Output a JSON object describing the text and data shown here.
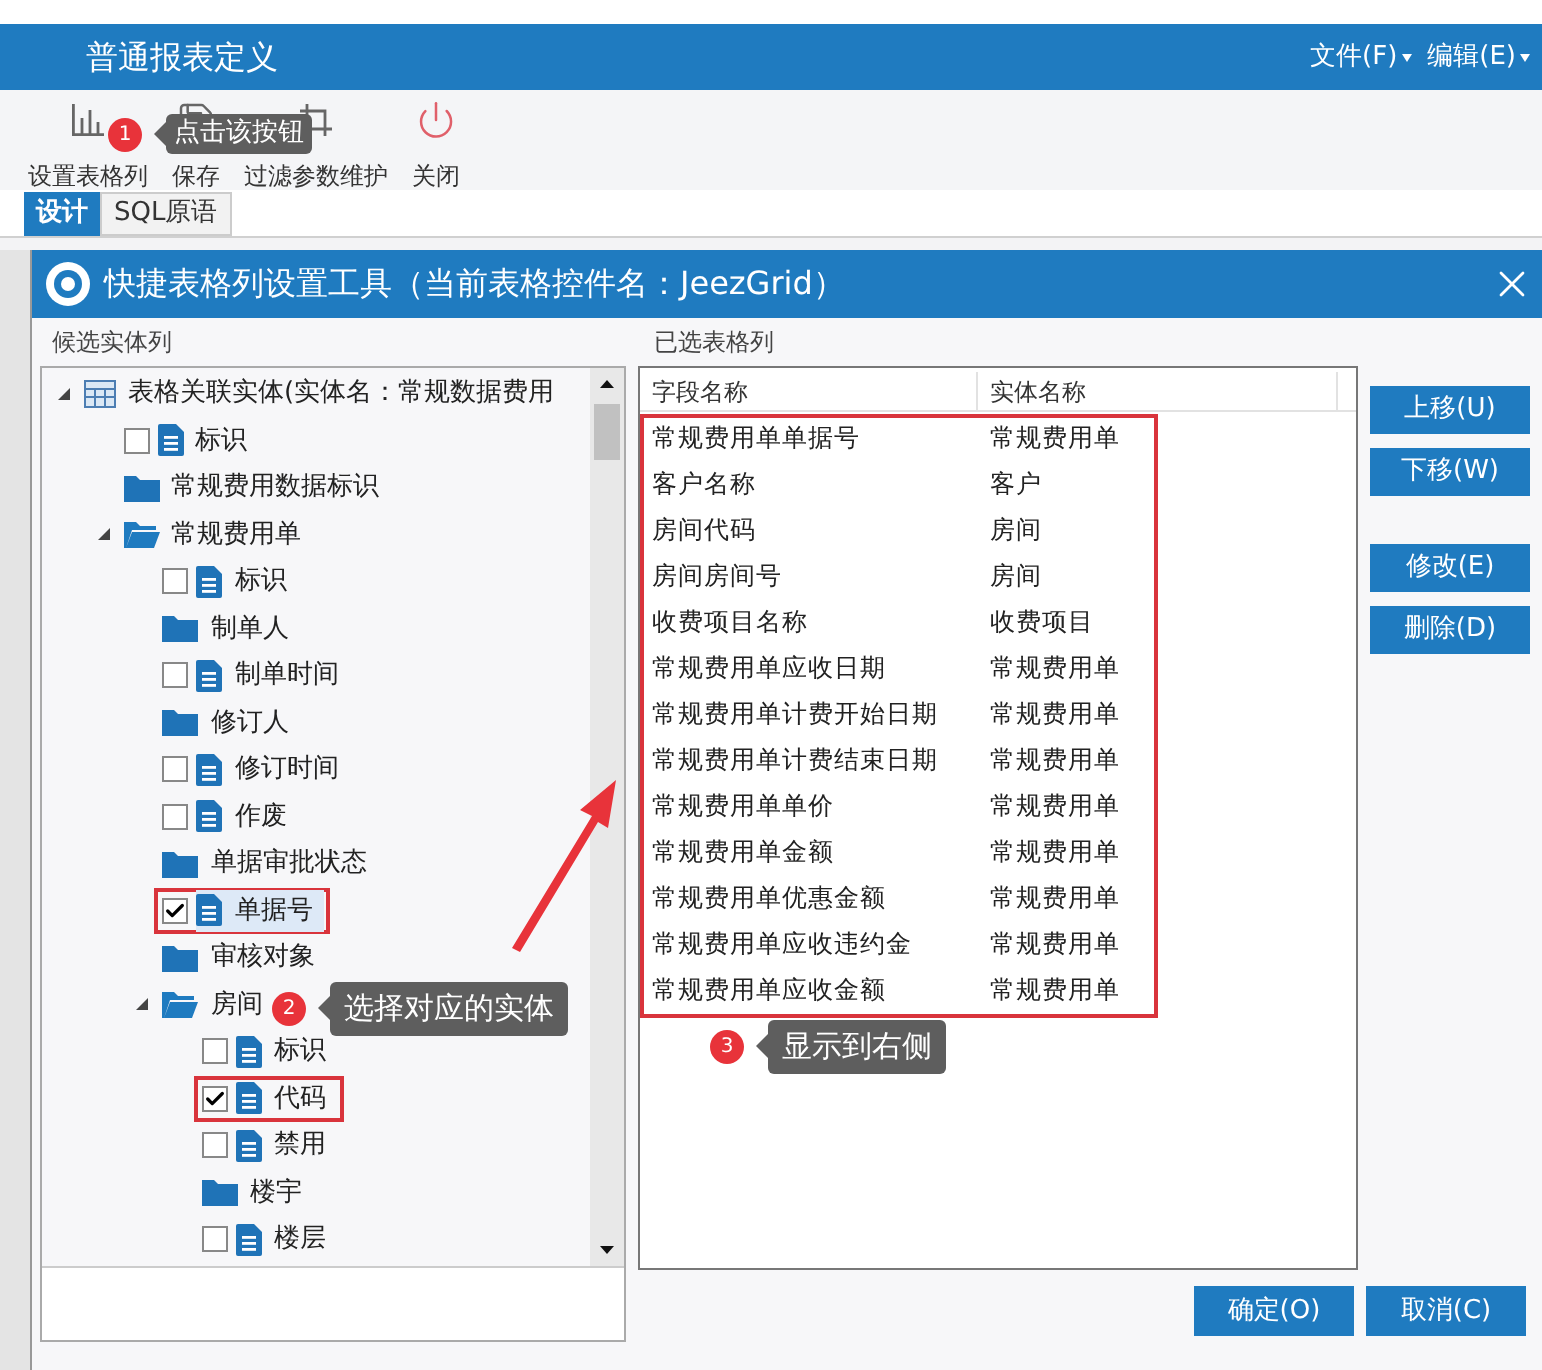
{
  "window": {
    "title": "普通报表定义",
    "menus": [
      {
        "label": "文件(F)"
      },
      {
        "label": "编辑(E)"
      }
    ]
  },
  "toolbar": [
    {
      "label": "设置表格列",
      "kind": "chart"
    },
    {
      "label": "保存",
      "kind": "save"
    },
    {
      "label": "过滤参数维护",
      "kind": "filter"
    },
    {
      "label": "关闭",
      "kind": "power"
    }
  ],
  "tabs": [
    {
      "label": "设计",
      "selected": true
    },
    {
      "label": "SQL原语",
      "selected": false
    }
  ],
  "dialog": {
    "title": "快捷表格列设置工具（当前表格控件名：JeezGrid）",
    "candidates": {
      "header": "候选实体列",
      "tree": [
        {
          "label": "表格关联实体(实体名：常规数据费用",
          "kind": "table",
          "expanded": true,
          "selected": false,
          "framed": false,
          "children": [
            {
              "label": "标识",
              "kind": "field",
              "checked": false,
              "selected": false,
              "framed": false
            },
            {
              "label": "常规费用数据标识",
              "kind": "folder",
              "expanded": false,
              "selected": false,
              "framed": false
            },
            {
              "label": "常规费用单",
              "kind": "folder",
              "expanded": true,
              "selected": false,
              "framed": false,
              "children": [
                {
                  "label": "标识",
                  "kind": "field",
                  "checked": false,
                  "selected": false,
                  "framed": false
                },
                {
                  "label": "制单人",
                  "kind": "folder",
                  "expanded": false,
                  "selected": false,
                  "framed": false
                },
                {
                  "label": "制单时间",
                  "kind": "field",
                  "checked": false,
                  "selected": false,
                  "framed": false
                },
                {
                  "label": "修订人",
                  "kind": "folder",
                  "expanded": false,
                  "selected": false,
                  "framed": false
                },
                {
                  "label": "修订时间",
                  "kind": "field",
                  "checked": false,
                  "selected": false,
                  "framed": false
                },
                {
                  "label": "作废",
                  "kind": "field",
                  "checked": false,
                  "selected": false,
                  "framed": false
                },
                {
                  "label": "单据审批状态",
                  "kind": "folder",
                  "expanded": false,
                  "selected": false,
                  "framed": false
                },
                {
                  "label": "单据号",
                  "kind": "field",
                  "checked": true,
                  "selected": true,
                  "framed": true
                },
                {
                  "label": "审核对象",
                  "kind": "folder",
                  "expanded": false,
                  "selected": false,
                  "framed": false
                },
                {
                  "label": "房间",
                  "kind": "folder",
                  "expanded": true,
                  "selected": false,
                  "framed": false,
                  "children": [
                    {
                      "label": "标识",
                      "kind": "field",
                      "checked": false,
                      "selected": false,
                      "framed": false
                    },
                    {
                      "label": "代码",
                      "kind": "field",
                      "checked": true,
                      "selected": false,
                      "framed": true
                    },
                    {
                      "label": "禁用",
                      "kind": "field",
                      "checked": false,
                      "selected": false,
                      "framed": false
                    },
                    {
                      "label": "楼宇",
                      "kind": "folder",
                      "expanded": false,
                      "selected": false,
                      "framed": false
                    },
                    {
                      "label": "楼层",
                      "kind": "field",
                      "checked": false,
                      "selected": false,
                      "framed": false
                    }
                  ]
                }
              ]
            }
          ]
        }
      ]
    },
    "selected_columns": {
      "header": "已选表格列",
      "columns": [
        "字段名称",
        "实体名称"
      ],
      "rows": [
        [
          "常规费用单单据号",
          "常规费用单"
        ],
        [
          "客户名称",
          "客户"
        ],
        [
          "房间代码",
          "房间"
        ],
        [
          "房间房间号",
          "房间"
        ],
        [
          "收费项目名称",
          "收费项目"
        ],
        [
          "常规费用单应收日期",
          "常规费用单"
        ],
        [
          "常规费用单计费开始日期",
          "常规费用单"
        ],
        [
          "常规费用单计费结束日期",
          "常规费用单"
        ],
        [
          "常规费用单单价",
          "常规费用单"
        ],
        [
          "常规费用单金额",
          "常规费用单"
        ],
        [
          "常规费用单优惠金额",
          "常规费用单"
        ],
        [
          "常规费用单应收违约金",
          "常规费用单"
        ],
        [
          "常规费用单应收金额",
          "常规费用单"
        ]
      ]
    },
    "side_buttons": [
      {
        "label": "上移(U)"
      },
      {
        "label": "下移(W)"
      },
      {
        "label": "修改(E)"
      },
      {
        "label": "删除(D)"
      }
    ],
    "footer_buttons": [
      {
        "label": "确定(O)"
      },
      {
        "label": "取消(C)"
      }
    ]
  },
  "annotations": [
    {
      "number": "1",
      "text": "点击该按钮"
    },
    {
      "number": "2",
      "text": "选择对应的实体"
    },
    {
      "number": "3",
      "text": "显示到右侧"
    }
  ]
}
